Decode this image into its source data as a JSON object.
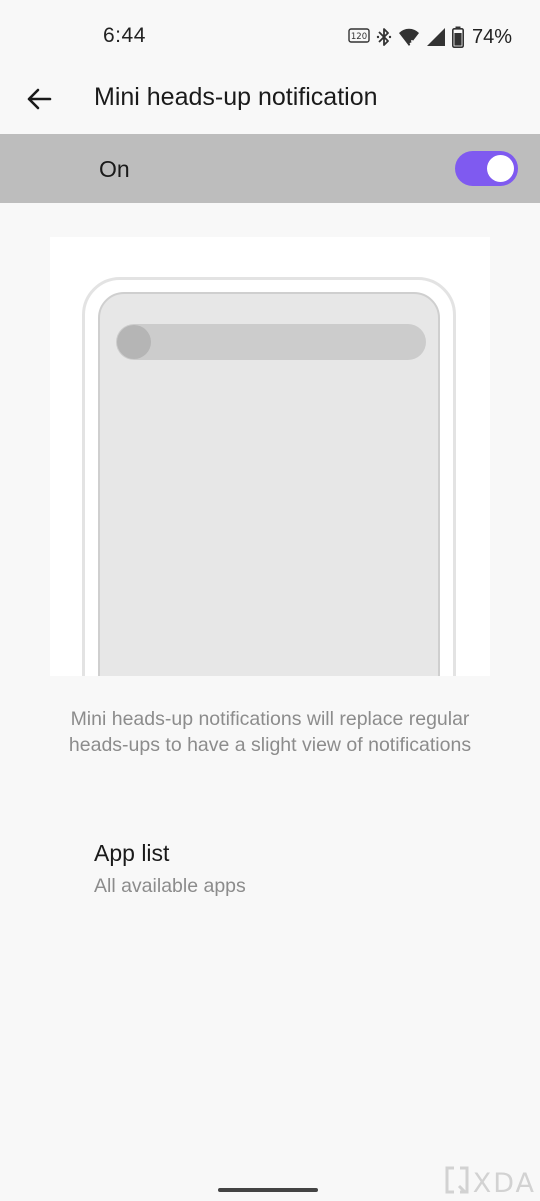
{
  "status_bar": {
    "time": "6:44",
    "refresh_badge": "120",
    "battery_percent": "74%",
    "icons": [
      "refresh-rate-icon",
      "bluetooth-icon",
      "wifi-icon",
      "cellular-signal-icon",
      "battery-icon"
    ]
  },
  "header": {
    "back_icon": "back-arrow-icon",
    "title": "Mini heads-up notification"
  },
  "master_switch": {
    "label": "On",
    "enabled": true,
    "accent_color": "#7f5af0"
  },
  "illustration": {
    "description": "Mini heads-up notifications will replace regular heads-ups to have a slight view of notifications"
  },
  "app_list": {
    "title": "App list",
    "subtitle": "All available apps"
  },
  "watermark": {
    "text": "XDA"
  }
}
